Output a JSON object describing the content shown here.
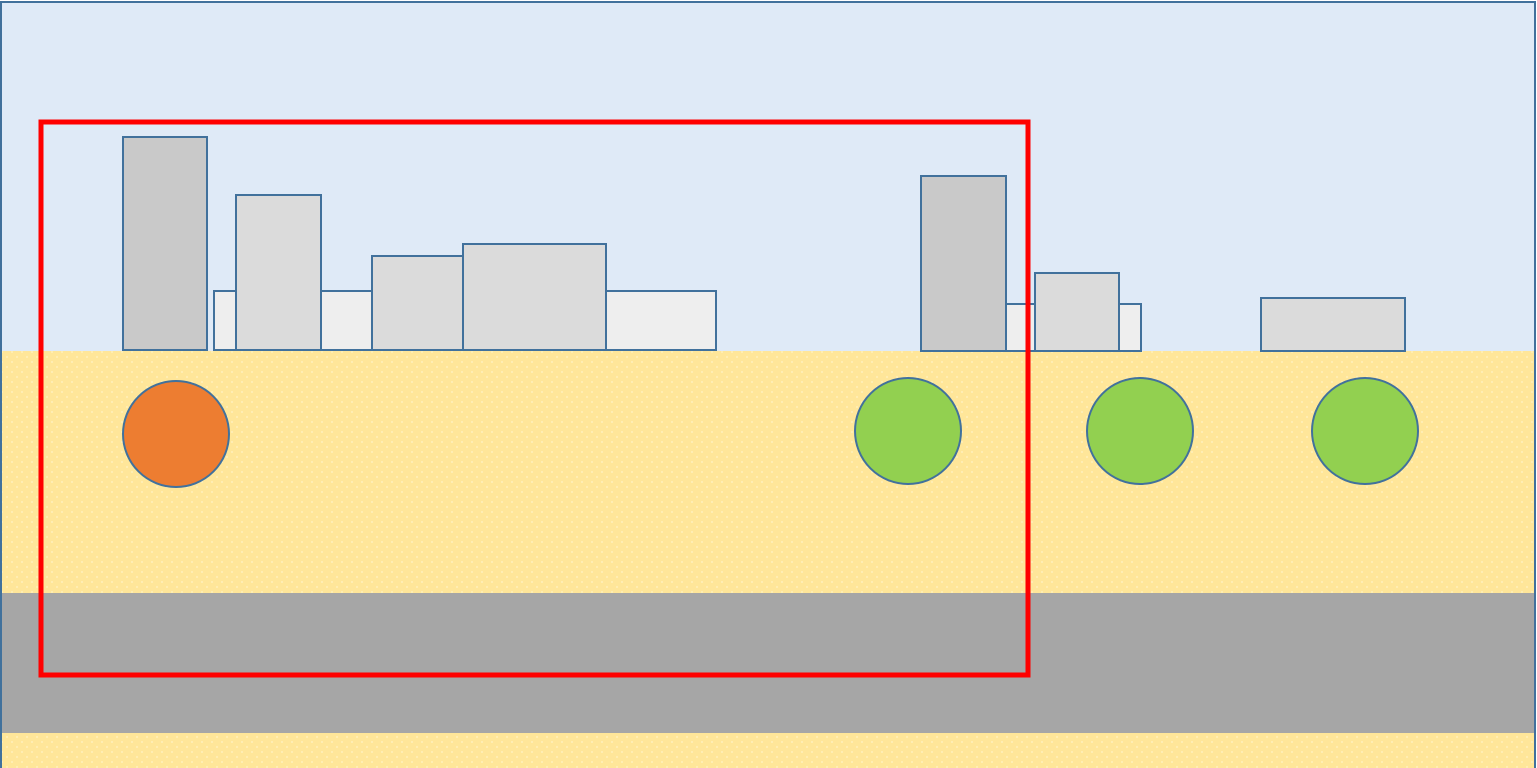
{
  "colors": {
    "sky": "#dfeaf7",
    "sand": "#ffe699",
    "sand_dots": "#fff3c6",
    "road": "#a6a6a6",
    "building_dark": "#c9c9c9",
    "building_mid": "#dbdbdb",
    "building_light": "#eeeeee",
    "outline": "#41719c",
    "person_highlighted": "#ed7d31",
    "person": "#92d050",
    "selection_frame": "#ff0000"
  },
  "scene": {
    "buildings": [
      {
        "id": "b1",
        "shade": "light"
      },
      {
        "id": "b2",
        "shade": "dark"
      },
      {
        "id": "b3",
        "shade": "mid"
      },
      {
        "id": "b4",
        "shade": "mid"
      },
      {
        "id": "b5",
        "shade": "mid"
      },
      {
        "id": "b6",
        "shade": "light"
      },
      {
        "id": "b7",
        "shade": "mid"
      },
      {
        "id": "b8",
        "shade": "dark"
      },
      {
        "id": "b9",
        "shade": "mid"
      },
      {
        "id": "b10",
        "shade": "mid"
      }
    ],
    "people": [
      {
        "id": "p1",
        "state": "highlighted"
      },
      {
        "id": "p2",
        "state": "normal"
      },
      {
        "id": "p3",
        "state": "normal"
      },
      {
        "id": "p4",
        "state": "normal"
      }
    ],
    "selection": {
      "visible": true
    }
  }
}
